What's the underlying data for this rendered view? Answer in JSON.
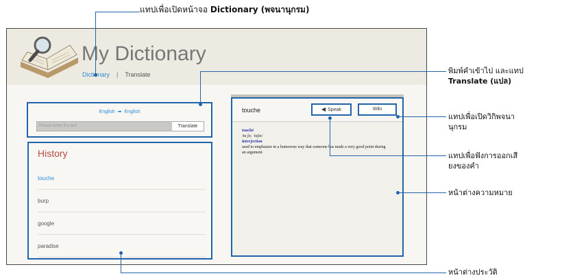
{
  "screenshot": {
    "app_title": "My Dictionary",
    "nav": {
      "dictionary": "Dictionary",
      "separator": "|",
      "translate": "Translate"
    },
    "translate_box": {
      "from": "English",
      "to": "English",
      "arrow": "➡",
      "placeholder": "Please enter the text",
      "button": "Translate"
    },
    "history": {
      "title": "History",
      "items": [
        "touche",
        "burp",
        "google",
        "paradise"
      ]
    },
    "meaning": {
      "word": "touche",
      "speak_button": "Speak",
      "wiki_button": "Wiki",
      "headword": "touché",
      "pronunciation": "/tu ʃe; ˈtuʃeɪ/",
      "part_of_speech": "interjection",
      "definition": "used to emphasize in a humorous way that someone has made a very good point during an argument"
    }
  },
  "callouts": {
    "dictionary_pre": "แทปเพื่อเปิดหน้าจอ ",
    "dictionary_bold": "Dictionary (พจนานุกรม)",
    "translate_pre": "พิมพ์คำเข้าไป และแทป",
    "translate_bold": "Translate (แปล)",
    "wiki_line1": "แทปเพื่อเปิดวิกิพจนา",
    "wiki_line2": "นุกรม",
    "speak_line1": "แทปเพื่อฟังการออกเสี",
    "speak_line2": "ยงของคำ",
    "meaning": "หน้าต่างความหมาย",
    "history": "หน้าต่างประวัติ"
  },
  "colors": {
    "accent": "#1f63a9",
    "link": "#2a8ad8",
    "history_title": "#b34a41"
  }
}
